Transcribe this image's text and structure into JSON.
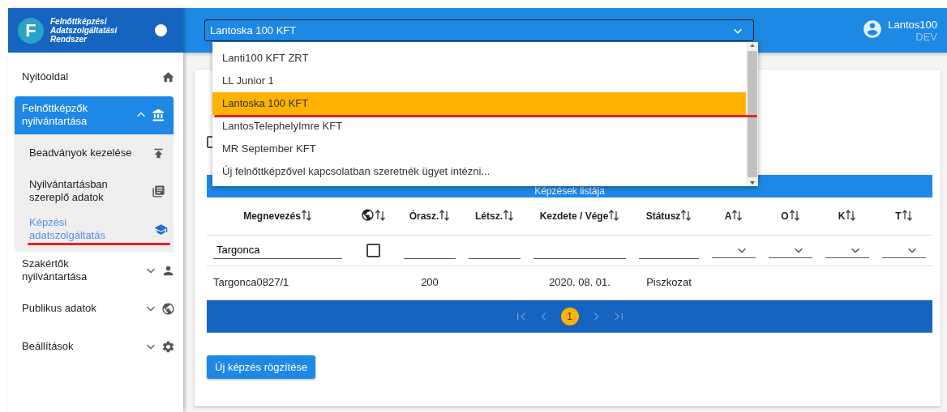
{
  "app": {
    "logo_letter": "F",
    "title_lines": [
      "Felnőttképzési",
      "Adatszolgáltatási",
      "Rendszer"
    ]
  },
  "header": {
    "organization_select": {
      "value": "Lantoska 100 KFT",
      "expanded": true
    },
    "user": {
      "name": "Lantos100",
      "environment": "DEV"
    }
  },
  "organization_options": [
    {
      "label": "Lanti100 KFT ZRT",
      "selected": false,
      "marked": false
    },
    {
      "label": "LL Junior 1",
      "selected": false,
      "marked": false
    },
    {
      "label": "Lantoska 100 KFT",
      "selected": true,
      "marked": true
    },
    {
      "label": "LantosTelephelyImre KFT",
      "selected": false,
      "marked": false
    },
    {
      "label": "MR September KFT",
      "selected": false,
      "marked": false
    },
    {
      "label": "Új felnőttképzővel kapcsolatban szeretnék ügyet intézni...",
      "selected": false,
      "marked": false
    }
  ],
  "sidebar": {
    "items": [
      {
        "label": "Nyitóoldal",
        "selected": false
      },
      {
        "label": "Felnőttképzők nyilvántartása",
        "selected": true,
        "expanded": true,
        "children": [
          {
            "label": "Beadványok kezelése",
            "selected": false,
            "marked": false
          },
          {
            "label": "Nyilvántartásban szereplő adatok",
            "selected": false,
            "marked": false
          },
          {
            "label": "Képzési adatszolgáltatás",
            "selected": true,
            "marked": true
          }
        ]
      },
      {
        "label": "Szakértők nyilvántartása",
        "selected": false,
        "expanded": false
      },
      {
        "label": "Publikus adatok",
        "selected": false,
        "expanded": false
      },
      {
        "label": "Beállítások",
        "selected": false,
        "expanded": false
      }
    ]
  },
  "page": {
    "select_all": {
      "checked": false
    }
  },
  "table": {
    "caption": "Képzések listája",
    "columns": [
      {
        "kind": "text",
        "label": "Megnevezés"
      },
      {
        "kind": "icon"
      },
      {
        "kind": "text",
        "label": "Órasz."
      },
      {
        "kind": "text",
        "label": "Létsz."
      },
      {
        "kind": "text",
        "label": "Kezdete / Vége"
      },
      {
        "kind": "text",
        "label": "Státusz"
      },
      {
        "kind": "text",
        "label": "A"
      },
      {
        "kind": "text",
        "label": "O"
      },
      {
        "kind": "text",
        "label": "K"
      },
      {
        "kind": "text",
        "label": "T"
      }
    ],
    "filters": [
      {
        "kind": "text",
        "value": "Targonca"
      },
      {
        "kind": "checkbox",
        "checked": false
      },
      {
        "kind": "text"
      },
      {
        "kind": "text"
      },
      {
        "kind": "text"
      },
      {
        "kind": "text"
      },
      {
        "kind": "select"
      },
      {
        "kind": "select"
      },
      {
        "kind": "select"
      },
      {
        "kind": "select"
      }
    ],
    "rows": [
      {
        "cells": [
          "Targonca0827/1",
          null,
          "200",
          null,
          "2020. 08. 01.",
          "Piszkozat",
          null,
          null,
          null,
          null
        ]
      }
    ],
    "pagination": {
      "nav": [
        {
          "kind": "first",
          "disabled": true
        },
        {
          "kind": "prev",
          "disabled": true
        },
        {
          "kind": "page",
          "label": "1",
          "selected": true
        },
        {
          "kind": "next",
          "disabled": true
        },
        {
          "kind": "last",
          "disabled": true
        }
      ]
    }
  },
  "new_button": "Új képzés rögzítése"
}
